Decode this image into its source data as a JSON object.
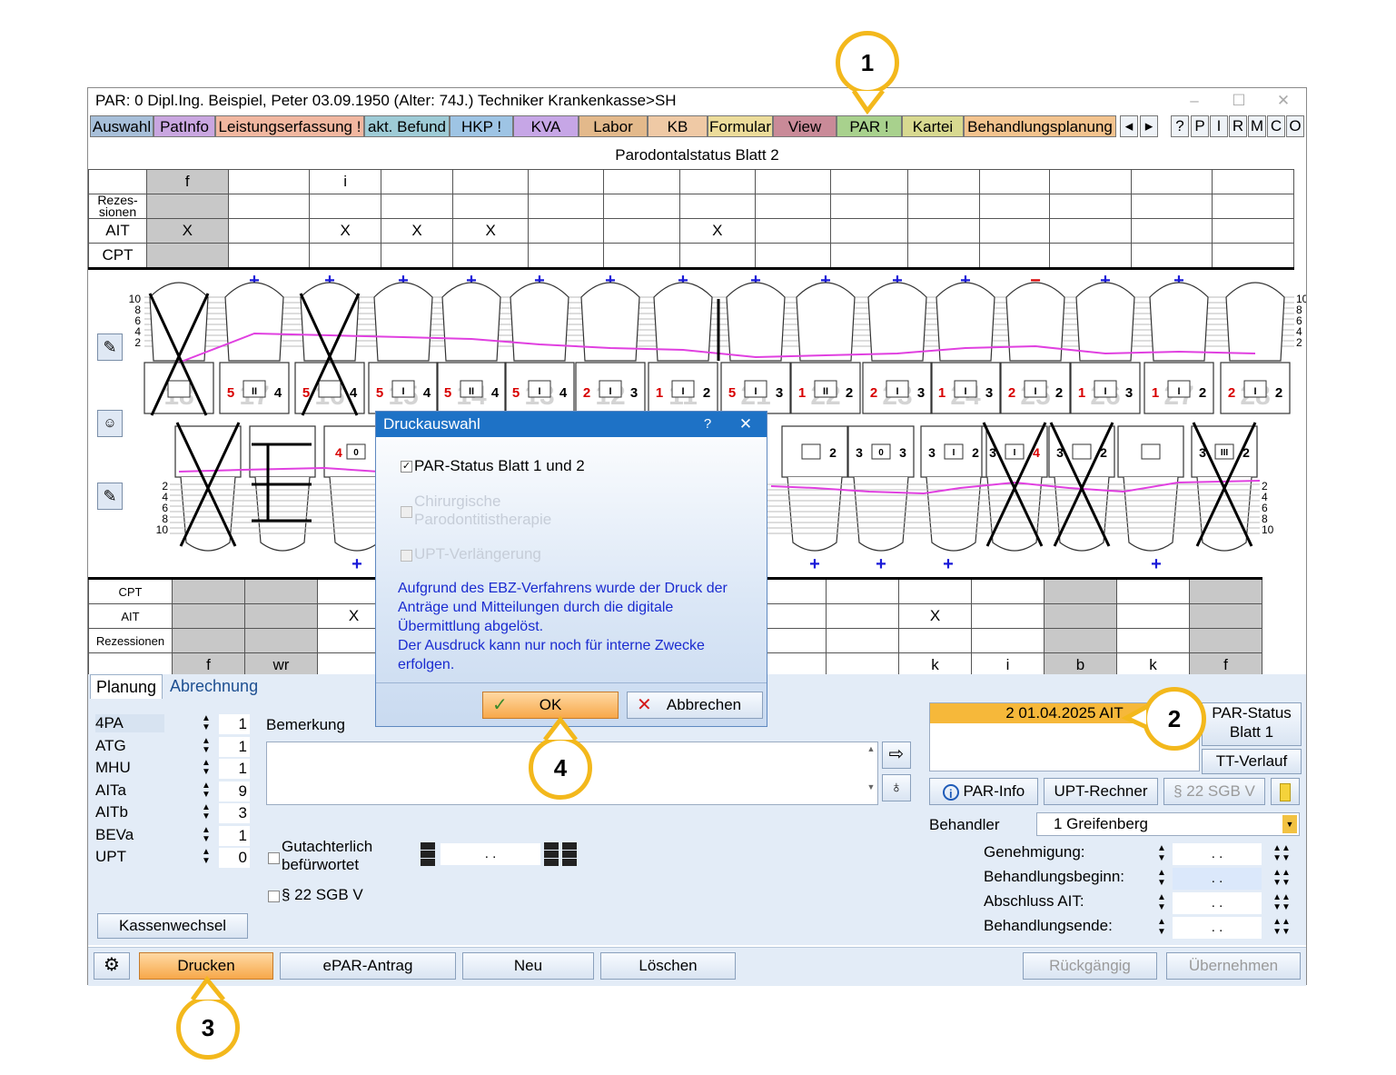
{
  "window": {
    "title": "PAR: 0  Dipl.Ing. Beispiel, Peter  03.09.1950 (Alter: 74J.)  Techniker Krankenkasse>SH",
    "min": "–",
    "max": "☐",
    "close": "✕"
  },
  "tabs": [
    {
      "label": "Auswahl",
      "color": "#a7bfd9"
    },
    {
      "label": "PatInfo",
      "color": "#c9a6e0"
    },
    {
      "label": "Leistungserfassung !",
      "color": "#f1b7a0"
    },
    {
      "label": "akt. Befund",
      "color": "#9ecbd6"
    },
    {
      "label": "HKP !",
      "color": "#9ec4e4"
    },
    {
      "label": "KVA",
      "color": "#c6a6e6"
    },
    {
      "label": "Labor",
      "color": "#e3b98b"
    },
    {
      "label": "KB",
      "color": "#efc9a5"
    },
    {
      "label": "Formular",
      "color": "#ecdc9a"
    },
    {
      "label": "View",
      "color": "#c98a98"
    },
    {
      "label": "PAR !",
      "color": "#a8d18d"
    },
    {
      "label": "Kartei",
      "color": "#d8d990"
    },
    {
      "label": "Behandlungsplanung",
      "color": "#f3c38e"
    }
  ],
  "tab_arrows": {
    "left": "◂",
    "right": "▸"
  },
  "help_icon": "?",
  "quick_buttons": [
    "P",
    "I",
    "R",
    "M",
    "C",
    "O"
  ],
  "section_title": "Parodontalstatus Blatt 2",
  "upper_table": {
    "top_marks": [
      "f",
      "",
      "i",
      "",
      "",
      "",
      "",
      "",
      "",
      "",
      "",
      "",
      "",
      "",
      "",
      ""
    ],
    "rows": [
      {
        "label": "Rezes-\nsionen",
        "cells": [
          "",
          "",
          "",
          "",
          "",
          "",
          "",
          "",
          "",
          "",
          "",
          "",
          "",
          "",
          "",
          ""
        ]
      },
      {
        "label": "AIT",
        "cells": [
          "",
          "X",
          "",
          "X",
          "X",
          "X",
          "",
          "",
          "X",
          "",
          "",
          "",
          "",
          "",
          "",
          ""
        ]
      },
      {
        "label": "CPT",
        "cells": [
          "",
          "",
          "",
          "",
          "",
          "",
          "",
          "",
          "",
          "",
          "",
          "",
          "",
          "",
          "",
          ""
        ]
      }
    ]
  },
  "chart": {
    "upper_plus": [
      "+",
      "+",
      "+",
      "+",
      "+",
      "+",
      "+",
      "+",
      "+",
      "+",
      "+",
      "−",
      "+",
      "+"
    ],
    "upper_scale": [
      "10",
      "8",
      "6",
      "4",
      "2"
    ],
    "lower_scale": [
      "2",
      "4",
      "6",
      "8",
      "10"
    ],
    "upper_teeth_labels": [
      "18",
      "17",
      "16",
      "15",
      "14",
      "13",
      "12",
      "11",
      "21",
      "22",
      "23",
      "24",
      "25",
      "26",
      "27",
      "28"
    ],
    "upper_boxes": [
      {
        "l": "",
        "m": "",
        "r": ""
      },
      {
        "l": "5",
        "m": "II",
        "r": "4"
      },
      {
        "l": "5",
        "m": "",
        "r": "4"
      },
      {
        "l": "5",
        "m": "I",
        "r": "4"
      },
      {
        "l": "5",
        "m": "II",
        "r": "4"
      },
      {
        "l": "5",
        "m": "I",
        "r": "4"
      },
      {
        "l": "2",
        "m": "I",
        "r": "3"
      },
      {
        "l": "1",
        "m": "I",
        "r": "2"
      },
      {
        "l": "5",
        "m": "I",
        "r": "3"
      },
      {
        "l": "1",
        "m": "II",
        "r": "2"
      },
      {
        "l": "2",
        "m": "I",
        "r": "3"
      },
      {
        "l": "1",
        "m": "I",
        "r": "3"
      },
      {
        "l": "2",
        "m": "I",
        "r": "2"
      },
      {
        "l": "1",
        "m": "I",
        "r": "3"
      },
      {
        "l": "1",
        "m": "I",
        "r": "2"
      },
      {
        "l": "2",
        "m": "I",
        "r": "2"
      }
    ],
    "lower_boxes": [
      {
        "l": "",
        "m": "",
        "r": ""
      },
      {
        "l": "",
        "m": "",
        "r": ""
      },
      {
        "l": "4",
        "m": "0",
        "r": ""
      },
      {
        "l": "",
        "m": "",
        "r": "2"
      },
      {
        "l": "3",
        "m": "0",
        "r": "3"
      },
      {
        "l": "3",
        "m": "I",
        "r": "2"
      },
      {
        "l": "3",
        "m": "I",
        "r": "4"
      },
      {
        "l": "3",
        "m": "",
        "r": "2"
      },
      {
        "l": "",
        "m": "",
        "r": ""
      },
      {
        "l": "3",
        "m": "III",
        "r": "2"
      },
      {
        "l": "",
        "m": "",
        "r": ""
      }
    ],
    "lower_plus": [
      "+",
      "+",
      "+",
      "+",
      "+"
    ]
  },
  "lower_table": {
    "rows": [
      {
        "label": "CPT"
      },
      {
        "label": "AIT",
        "cells": [
          "",
          "",
          "X",
          "",
          "",
          "",
          "",
          "",
          "",
          "",
          "X",
          "",
          "",
          "",
          ""
        ]
      },
      {
        "label": "Rezessionen"
      }
    ],
    "bottom_marks": [
      "f",
      "wr",
      "",
      "",
      "",
      "",
      "",
      "",
      "",
      "",
      "k",
      "i",
      "b",
      "k",
      "f"
    ]
  },
  "subtabs": [
    "Planung",
    "Abrechnung"
  ],
  "counters": [
    {
      "label": "4PA",
      "value": "1"
    },
    {
      "label": "ATG",
      "value": "1"
    },
    {
      "label": "MHU",
      "value": "1"
    },
    {
      "label": "AITa",
      "value": "9"
    },
    {
      "label": "AITb",
      "value": "3"
    },
    {
      "label": "BEVa",
      "value": "1"
    },
    {
      "label": "UPT",
      "value": "0"
    }
  ],
  "bemerkung_label": "Bemerkung",
  "gutachterlich_label": "Gutachterlich\nbefürwortet",
  "sgb_label": "§ 22 SGB V",
  "date_placeholder": ". .",
  "kassenwechsel": "Kassenwechsel",
  "status_entry": "2 01.04.2025  AIT",
  "par_status_btn": "PAR-Status\nBlatt 1",
  "tt_verlauf": "TT-Verlauf",
  "par_info": "PAR-Info",
  "upt_rechner": "UPT-Rechner",
  "sgb_btn": "§ 22 SGB V",
  "behandler_label": "Behandler",
  "behandler_value": "1 Greifenberg",
  "dates": [
    {
      "label": "Genehmigung:",
      "value": ". ."
    },
    {
      "label": "Behandlungsbeginn:",
      "value": ". ."
    },
    {
      "label": "Abschluss AIT:",
      "value": ". ."
    },
    {
      "label": "Behandlungsende:",
      "value": ". ."
    }
  ],
  "toolbar": {
    "drucken": "Drucken",
    "epar": "ePAR-Antrag",
    "neu": "Neu",
    "loeschen": "Löschen",
    "rueckgaengig": "Rückgängig",
    "uebernehmen": "Übernehmen"
  },
  "dialog": {
    "title": "Druckauswahl",
    "help": "?",
    "close": "✕",
    "opt1": "PAR-Status Blatt 1 und 2",
    "opt2": "Chirurgische\nParodontitistherapie",
    "opt3": "UPT-Verlängerung",
    "info": "Aufgrund des EBZ-Verfahrens wurde der Druck der Anträge und Mitteilungen durch die digitale Übermittlung abgelöst.\nDer Ausdruck kann nur noch für interne Zwecke erfolgen.",
    "ok": "OK",
    "cancel": "Abbrechen"
  },
  "callouts": [
    "1",
    "2",
    "3",
    "4"
  ],
  "colors": {
    "accent": "#f3b81c",
    "pocket_line": "#e040e0",
    "plus": "#1a1ad8",
    "red_number": "#d80000"
  }
}
